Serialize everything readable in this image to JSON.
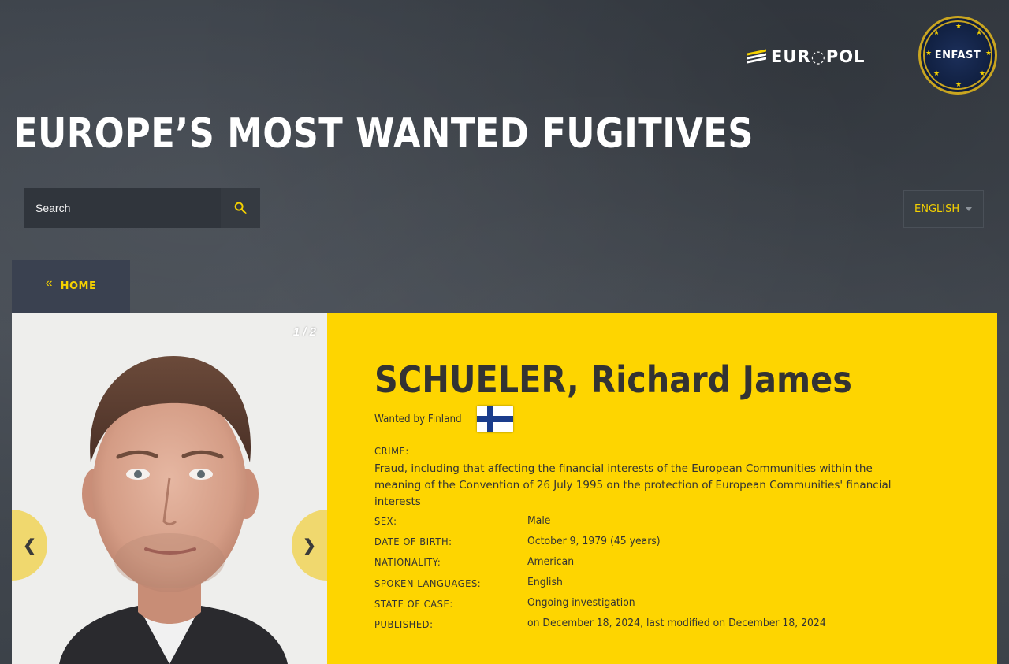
{
  "header": {
    "europol_logo_text": "EUR◌POL",
    "enfast_logo_text": "ENFAST",
    "page_title": "EUROPE’S MOST WANTED FUGITIVES"
  },
  "search": {
    "placeholder": "Search",
    "icon": "search-icon"
  },
  "language": {
    "selected": "ENGLISH"
  },
  "nav": {
    "home_label": "HOME",
    "home_icon": "double-chevron-left-icon"
  },
  "gallery": {
    "counter": "1 / 2",
    "prev_label": "❮",
    "next_label": "❯"
  },
  "person": {
    "name": "SCHUELER, Richard James",
    "wanted_by": "Wanted by Finland",
    "flag": "finland-flag",
    "fields": {
      "crime_label": "CRIME:",
      "crime_value": "Fraud, including that affecting the financial interests of the European Communities within the meaning of the Convention of 26 July 1995 on the protection of European Communities' financial interests",
      "sex_label": "SEX:",
      "sex_value": "Male",
      "dob_label": "DATE OF BIRTH:",
      "dob_value": "October 9, 1979 (45 years)",
      "nationality_label": "NATIONALITY:",
      "nationality_value": "American",
      "languages_label": "SPOKEN LANGUAGES:",
      "languages_value": "English",
      "state_label": "STATE OF CASE:",
      "state_value": "Ongoing investigation",
      "published_label": "PUBLISHED:",
      "published_value": "on December 18, 2024, last modified on December 18, 2024"
    }
  },
  "colors": {
    "accent_yellow": "#fed500",
    "dark_bg": "#3d434b",
    "text_dark": "#333333"
  }
}
